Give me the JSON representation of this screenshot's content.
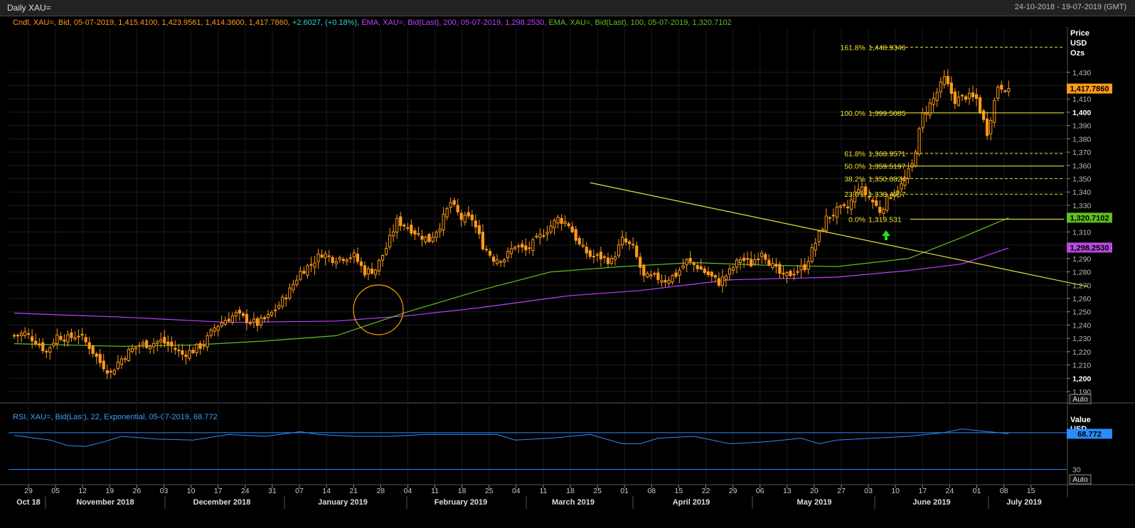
{
  "window": {
    "title": "Daily XAU=",
    "date_range": "24-10-2018 - 19-07-2019 (GMT)",
    "auto_label": "Auto"
  },
  "legend": {
    "cndl": "Cndl, XAU=, Bid, 05-07-2019, 1,415.4100, 1,423.9561, 1,414.3600, 1,417.7860, ",
    "change": "+2.6027, (+0.18%), ",
    "ema200": "EMA, XAU=, Bid(Last), 200, 05-07-2019, 1,298.2530, ",
    "ema100": "EMA, XAU=, Bid(Last), 100, 05-07-2019, 1,320.7102",
    "rsi": "RSI, XAU=, Bid(Last), 22, Exponential, 05-07-2019, 68.772"
  },
  "colors": {
    "candle": "#ff9a1a",
    "ema200": "#c040ff",
    "ema100": "#5fc020",
    "trendline": "#e8e03a",
    "fib": "#f0e030",
    "rsi": "#2a8cff",
    "up_arrow": "#22dd22",
    "circle": "#ffa500"
  },
  "chart_data": [
    {
      "type": "candlestick",
      "title": "Daily XAU=",
      "ylabel": "Price USD Ozs",
      "ylim": [
        1182,
        1463
      ],
      "yticks": [
        "1,190",
        "1,200",
        "1,210",
        "1,220",
        "1,230",
        "1,240",
        "1,250",
        "1,260",
        "1,270",
        "1,280",
        "1,290",
        "1,300",
        "1,310",
        "1,320",
        "1,330",
        "1,340",
        "1,350",
        "1,360",
        "1,370",
        "1,380",
        "1,390",
        "1,400",
        "1,410",
        "1,420",
        "1,430"
      ],
      "bold_yticks": [
        "1,200",
        "1,300",
        "1,400"
      ],
      "xticks": [
        "29",
        "05",
        "12",
        "19",
        "26",
        "03",
        "10",
        "17",
        "24",
        "31",
        "07",
        "14",
        "21",
        "28",
        "04",
        "11",
        "18",
        "25",
        "04",
        "11",
        "18",
        "25",
        "01",
        "08",
        "15",
        "22",
        "29",
        "06",
        "13",
        "20",
        "27",
        "03",
        "10",
        "17",
        "24",
        "01",
        "08",
        "15"
      ],
      "months": [
        "Oct 18",
        "November 2018",
        "December 2018",
        "January 2019",
        "February 2019",
        "March 2019",
        "April 2019",
        "May 2019",
        "June 2019",
        "July 2019"
      ],
      "last_price": {
        "label": "1,417.7860",
        "value": 1417.786
      },
      "ema100": {
        "label": "1,320.7102",
        "value": 1320.7102
      },
      "ema200": {
        "label": "1,298.2530",
        "value": 1298.253
      },
      "close_path": [
        [
          0,
          1232
        ],
        [
          3,
          1234
        ],
        [
          6,
          1228
        ],
        [
          9,
          1220
        ],
        [
          12,
          1232
        ],
        [
          15,
          1230
        ],
        [
          18,
          1233
        ],
        [
          21,
          1224
        ],
        [
          24,
          1212
        ],
        [
          27,
          1204
        ],
        [
          29,
          1212
        ],
        [
          32,
          1220
        ],
        [
          35,
          1225
        ],
        [
          38,
          1226
        ],
        [
          41,
          1228
        ],
        [
          44,
          1224
        ],
        [
          47,
          1218
        ],
        [
          50,
          1221
        ],
        [
          53,
          1226
        ],
        [
          56,
          1238
        ],
        [
          59,
          1244
        ],
        [
          62,
          1248
        ],
        [
          65,
          1244
        ],
        [
          68,
          1241
        ],
        [
          71,
          1246
        ],
        [
          74,
          1255
        ],
        [
          77,
          1266
        ],
        [
          80,
          1280
        ],
        [
          83,
          1286
        ],
        [
          86,
          1294
        ],
        [
          89,
          1290
        ],
        [
          92,
          1291
        ],
        [
          95,
          1292
        ],
        [
          98,
          1280
        ],
        [
          101,
          1282
        ],
        [
          104,
          1298
        ],
        [
          107,
          1318
        ],
        [
          110,
          1314
        ],
        [
          113,
          1308
        ],
        [
          116,
          1304
        ],
        [
          119,
          1315
        ],
        [
          122,
          1332
        ],
        [
          125,
          1320
        ],
        [
          128,
          1320
        ],
        [
          131,
          1300
        ],
        [
          134,
          1290
        ],
        [
          137,
          1290
        ],
        [
          140,
          1300
        ],
        [
          143,
          1296
        ],
        [
          146,
          1304
        ],
        [
          149,
          1312
        ],
        [
          152,
          1320
        ],
        [
          155,
          1316
        ],
        [
          158,
          1300
        ],
        [
          161,
          1292
        ],
        [
          164,
          1291
        ],
        [
          167,
          1288
        ],
        [
          170,
          1304
        ],
        [
          173,
          1298
        ],
        [
          176,
          1276
        ],
        [
          179,
          1276
        ],
        [
          182,
          1274
        ],
        [
          185,
          1278
        ],
        [
          188,
          1288
        ],
        [
          191,
          1284
        ],
        [
          194,
          1278
        ],
        [
          197,
          1272
        ],
        [
          200,
          1280
        ],
        [
          203,
          1290
        ],
        [
          206,
          1286
        ],
        [
          209,
          1296
        ],
        [
          212,
          1284
        ],
        [
          215,
          1276
        ],
        [
          218,
          1280
        ],
        [
          221,
          1284
        ],
        [
          224,
          1302
        ],
        [
          227,
          1320
        ],
        [
          230,
          1326
        ],
        [
          233,
          1328
        ],
        [
          236,
          1344
        ],
        [
          239,
          1336
        ],
        [
          242,
          1326
        ],
        [
          245,
          1338
        ],
        [
          248,
          1345
        ],
        [
          251,
          1360
        ],
        [
          254,
          1398
        ],
        [
          257,
          1410
        ],
        [
          260,
          1425
        ],
        [
          263,
          1409
        ],
        [
          266,
          1412
        ],
        [
          269,
          1410
        ],
        [
          272,
          1385
        ],
        [
          275,
          1420
        ],
        [
          278,
          1418
        ]
      ],
      "fibonacci": [
        {
          "label": "161.8%",
          "value_label": "1,448.9346",
          "value": 1448.9346,
          "style": "dashed"
        },
        {
          "label": "100.0%",
          "value_label": "1,399.5085",
          "value": 1399.5085,
          "style": "solid"
        },
        {
          "label": "61.8%",
          "value_label": "1,368.9571",
          "value": 1368.9571,
          "style": "dashed"
        },
        {
          "label": "50.0%",
          "value_label": "1,359.5197",
          "value": 1359.5197,
          "style": "solid"
        },
        {
          "label": "38.2%",
          "value_label": "1,350.0824",
          "value": 1350.0824,
          "style": "dashed"
        },
        {
          "label": "23.6%",
          "value_label": "1,338.4057",
          "value": 1338.4057,
          "style": "dashed"
        },
        {
          "label": "0.0%",
          "value_label": "1,319.531",
          "value": 1319.531,
          "style": "solid"
        }
      ],
      "ema200_path": [
        [
          0,
          1249
        ],
        [
          30,
          1246
        ],
        [
          60,
          1242
        ],
        [
          90,
          1243
        ],
        [
          110,
          1247
        ],
        [
          130,
          1253
        ],
        [
          155,
          1262
        ],
        [
          175,
          1266
        ],
        [
          200,
          1274
        ],
        [
          230,
          1276
        ],
        [
          250,
          1281
        ],
        [
          265,
          1286
        ],
        [
          278,
          1298
        ]
      ],
      "ema100_path": [
        [
          0,
          1226
        ],
        [
          30,
          1224
        ],
        [
          50,
          1225
        ],
        [
          70,
          1228
        ],
        [
          90,
          1232
        ],
        [
          110,
          1250
        ],
        [
          130,
          1266
        ],
        [
          150,
          1280
        ],
        [
          170,
          1284
        ],
        [
          190,
          1287
        ],
        [
          210,
          1285
        ],
        [
          230,
          1284
        ],
        [
          250,
          1290
        ],
        [
          265,
          1306
        ],
        [
          278,
          1320.7
        ]
      ],
      "trendline": [
        [
          161,
          1347
        ],
        [
          300,
          1269
        ]
      ]
    },
    {
      "type": "line",
      "title": "RSI",
      "ylabel": "Value USD",
      "ylim": [
        15,
        100
      ],
      "yticks": [
        "30"
      ],
      "levels": [
        30,
        70
      ],
      "last_value": {
        "label": "68.772",
        "value": 68.772
      },
      "partial_tick": "70",
      "path": [
        [
          0,
          67
        ],
        [
          10,
          62
        ],
        [
          15,
          56
        ],
        [
          20,
          55
        ],
        [
          25,
          60
        ],
        [
          30,
          66
        ],
        [
          40,
          63
        ],
        [
          50,
          62
        ],
        [
          60,
          68
        ],
        [
          70,
          66
        ],
        [
          80,
          71
        ],
        [
          85,
          68
        ],
        [
          95,
          66
        ],
        [
          105,
          66
        ],
        [
          115,
          68
        ],
        [
          125,
          68
        ],
        [
          135,
          68
        ],
        [
          140,
          62
        ],
        [
          150,
          64
        ],
        [
          161,
          68
        ],
        [
          170,
          58
        ],
        [
          175,
          58
        ],
        [
          180,
          64
        ],
        [
          190,
          66
        ],
        [
          200,
          58
        ],
        [
          210,
          60
        ],
        [
          220,
          64
        ],
        [
          225,
          58
        ],
        [
          230,
          62
        ],
        [
          240,
          64
        ],
        [
          250,
          66
        ],
        [
          260,
          70
        ],
        [
          265,
          74
        ],
        [
          270,
          72
        ],
        [
          275,
          70
        ],
        [
          278,
          68.772
        ]
      ]
    }
  ]
}
